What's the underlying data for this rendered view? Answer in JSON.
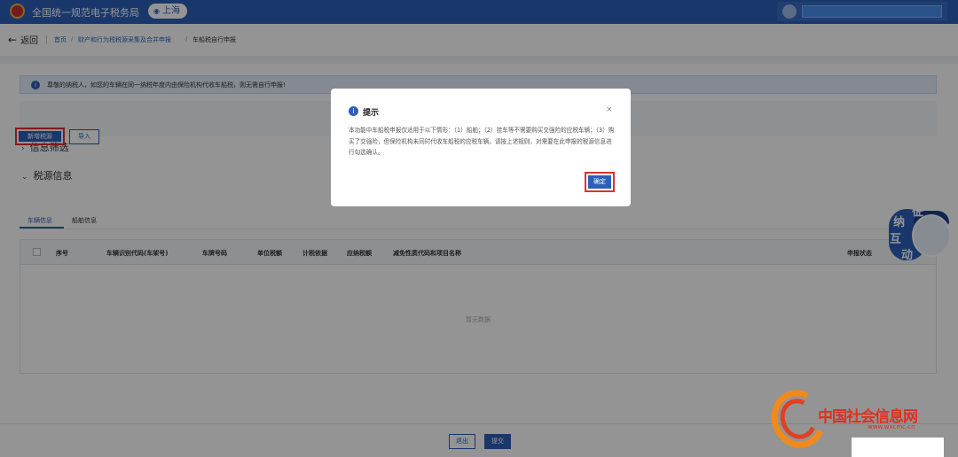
{
  "header": {
    "app_title": "全国统一规范电子税务局",
    "region": "上海",
    "region_icon": "location-pin-icon"
  },
  "breadcrumb": {
    "back_label": "返回",
    "items": [
      "首页",
      "财产和行为税税源采集及合并申报",
      "车船税自行申报"
    ]
  },
  "notice": {
    "text": "尊敬的纳税人，如您的车辆在同一纳税年度内由保险机构代收车船税，则无需自行申报!"
  },
  "sections": {
    "filter_title": "信息筛选",
    "source_title": "税源信息"
  },
  "actions": {
    "add_label": "新增税源",
    "import_label": "导入"
  },
  "tabs": [
    {
      "label": "车辆信息",
      "active": true
    },
    {
      "label": "船舶信息",
      "active": false
    }
  ],
  "table": {
    "columns": [
      "序号",
      "车辆识别代码(车架号)",
      "车牌号码",
      "单位税额",
      "计税依据",
      "应纳税额",
      "减免性质代码和项目名称",
      "申报状态"
    ],
    "empty_text": "暂无数据"
  },
  "footer": {
    "back_label": "退出",
    "submit_label": "提交"
  },
  "dialog": {
    "title": "提示",
    "close_glyph": "×",
    "body": "本功能中车船税申报仅适用于以下情形：（1）船舶；（2）挂车等不需要购买交强险的应税车辆；（3）购买了交强险，但保险机构未同时代收车船税的应税车辆。请按上述规则，对需要在此申报的税源信息进行勾选确认。",
    "ok_label": "确定"
  },
  "helper": {
    "chars": [
      "征",
      "纳",
      "互",
      "动"
    ]
  },
  "watermark": {
    "text": "中国社会信息网",
    "url": "www.wxcmc.cn"
  },
  "colors": {
    "brand": "#2d5fb8",
    "highlight": "#e03030"
  }
}
